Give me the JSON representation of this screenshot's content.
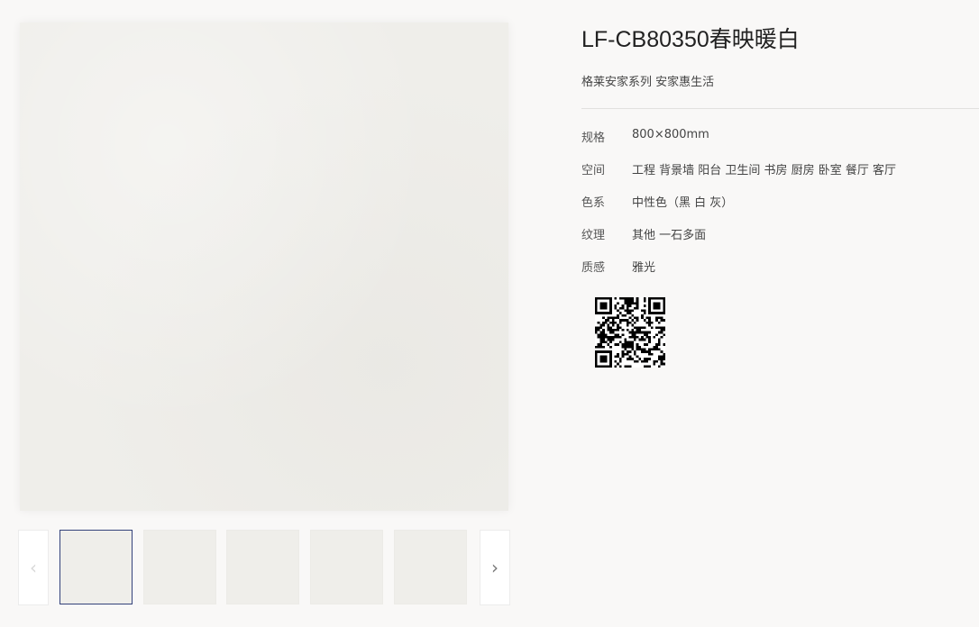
{
  "product": {
    "title": "LF-CB80350春映暖白",
    "subtitle": "格莱安家系列 安家惠生活"
  },
  "specs": [
    {
      "label": "规格",
      "value": "800×800mm"
    },
    {
      "label": "空间",
      "value": "工程 背景墙 阳台 卫生间 书房 厨房 卧室 餐厅 客厅"
    },
    {
      "label": "色系",
      "value": "中性色（黑 白 灰）"
    },
    {
      "label": "纹理",
      "value": "其他 一石多面"
    },
    {
      "label": "质感",
      "value": "雅光"
    }
  ],
  "gallery": {
    "prev_icon": "chevron-left-icon",
    "next_icon": "chevron-right-icon",
    "prev_glyph": "‹",
    "next_glyph": "›",
    "thumbnail_count": 5,
    "active_index": 0,
    "tile_color": "#efeeea",
    "active_border_color": "#33427a"
  },
  "qr_code": {
    "icon": "qr-code-icon"
  }
}
